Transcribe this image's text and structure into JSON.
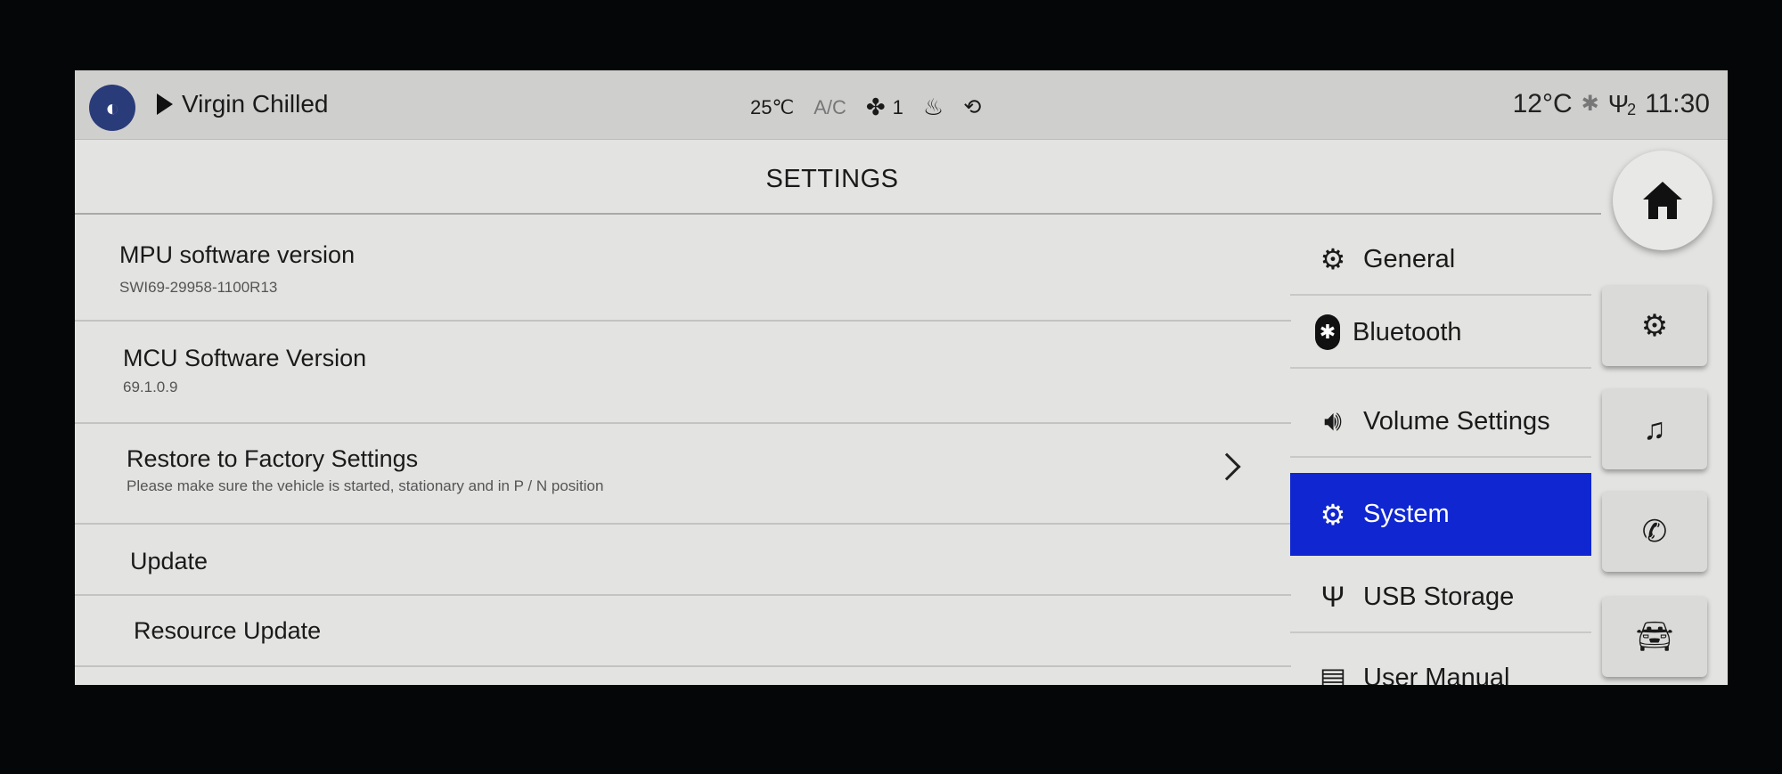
{
  "status_bar": {
    "source_icon": "radio-icon",
    "media_title": "Virgin Chilled",
    "cabin_temp": "25℃",
    "ac_label": "A/C",
    "fan_speed": "1",
    "outside_temp": "12°C",
    "usb_count": "2",
    "time": "11:30"
  },
  "header": {
    "title": "SETTINGS"
  },
  "settings_rows": [
    {
      "title": "MPU software version",
      "subtitle": "SWI69-29958-1100R13"
    },
    {
      "title": "MCU Software Version",
      "subtitle": "69.1.0.9"
    },
    {
      "title": "Restore to Factory Settings",
      "subtitle": "Please make sure the vehicle is started, stationary and in P / N position"
    },
    {
      "title": "Update"
    },
    {
      "title": "Resource Update"
    }
  ],
  "menu": [
    {
      "label": "General",
      "icon": "gear-icon"
    },
    {
      "label": "Bluetooth",
      "icon": "bluetooth-icon"
    },
    {
      "label": "Volume Settings",
      "icon": "speaker-icon"
    },
    {
      "label": "System",
      "icon": "gears-icon",
      "active": true
    },
    {
      "label": "USB Storage",
      "icon": "usb-icon"
    },
    {
      "label": "User Manual",
      "icon": "document-icon"
    }
  ],
  "dock": [
    "home-icon",
    "gear-icon",
    "music-icon",
    "phone-icon",
    "car-icon"
  ],
  "colors": {
    "accent": "#1026d0"
  }
}
